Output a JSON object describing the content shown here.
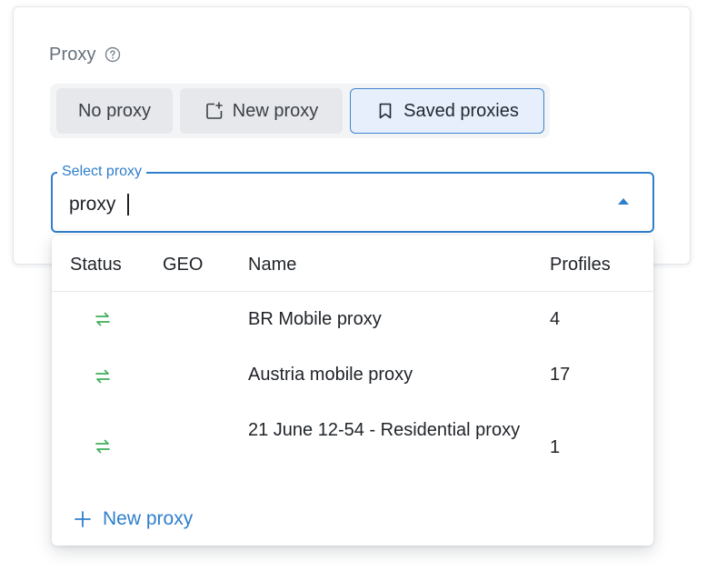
{
  "proxy_section": {
    "label": "Proxy",
    "help_icon": "help-circle-icon"
  },
  "segmented": {
    "no_proxy_label": "No proxy",
    "new_proxy_label": "New proxy",
    "new_proxy_icon": "add-square-icon",
    "saved_proxies_label": "Saved proxies",
    "saved_proxies_icon": "bookmark-icon",
    "selected": "Saved proxies"
  },
  "select": {
    "legend": "Select proxy",
    "value": "proxy",
    "arrow_icon": "caret-up-icon"
  },
  "dropdown": {
    "columns": {
      "status": "Status",
      "geo": "GEO",
      "name": "Name",
      "profiles": "Profiles"
    },
    "rows": [
      {
        "status_icon": "swap-arrows-icon",
        "geo": "",
        "name": "BR Mobile proxy",
        "profiles": "4"
      },
      {
        "status_icon": "swap-arrows-icon",
        "geo": "",
        "name": "Austria mobile proxy",
        "profiles": "17"
      },
      {
        "status_icon": "swap-arrows-icon",
        "geo": "",
        "name": "21 June 12-54 - Residential proxy",
        "profiles": "1"
      }
    ],
    "new_proxy_label": "New proxy",
    "new_proxy_icon": "plus-icon"
  },
  "colors": {
    "accent": "#2f7fcc",
    "status_ok": "#3fae5a",
    "selected_bg": "#e6effb",
    "button_bg": "#e7e8eb",
    "label_gray": "#66707c"
  }
}
